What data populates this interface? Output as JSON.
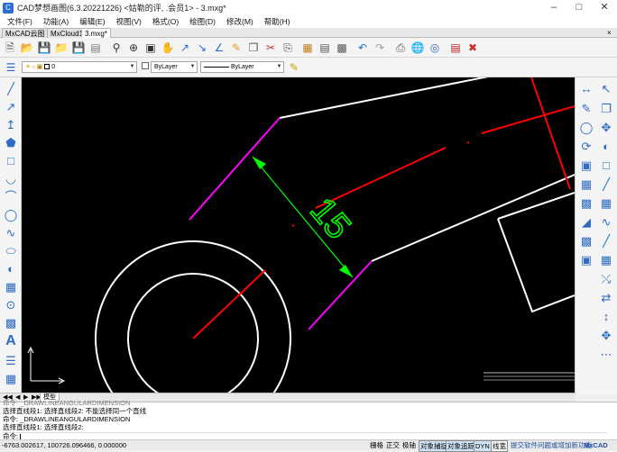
{
  "window": {
    "title": "CAD梦想画图(6.3.20221226) <姑勒的评, .会员1> - 3.mxg*"
  },
  "menu": [
    "文件(F)",
    "功能(A)",
    "编辑(E)",
    "视图(V)",
    "格式(O)",
    "绘图(D)",
    "修改(M)",
    "帮助(H)"
  ],
  "tabs": [
    "MxCAD云图",
    "MxCloud1",
    "3.mxg*"
  ],
  "layer": {
    "name": "0",
    "color": "ByLayer",
    "linetype": "ByLayer"
  },
  "drawing": {
    "dimension_text": "15"
  },
  "model_tabs": [
    "模型"
  ],
  "command_history": [
    "命令: _DRAWLINEANGULARDIMENSION",
    "选择直线段1:  选择直线段2:  不能选择同一个直线",
    "命令: _DRAWLINEANGULARDIMENSION",
    "选择直线段1:  选择直线段2:"
  ],
  "command_prompt": "命令:",
  "status": {
    "coords": "-6763.002617,  100726.096466,  0.000000",
    "toggles": [
      "栅格",
      "正交",
      "极轴",
      "对象捕捉",
      "对象追踪",
      "DYN",
      "线宽"
    ],
    "active_toggles": [
      "对象捕捉",
      "对象追踪",
      "DYN"
    ],
    "promo": "提交软件问题或增加新功能",
    "brand": "MxCAD"
  },
  "colors": {
    "background": "#000000",
    "geometry": "#ffffff",
    "centerline": "#ff0000",
    "dimension": "#00ff00",
    "dim_ext": "#ff00ff"
  }
}
